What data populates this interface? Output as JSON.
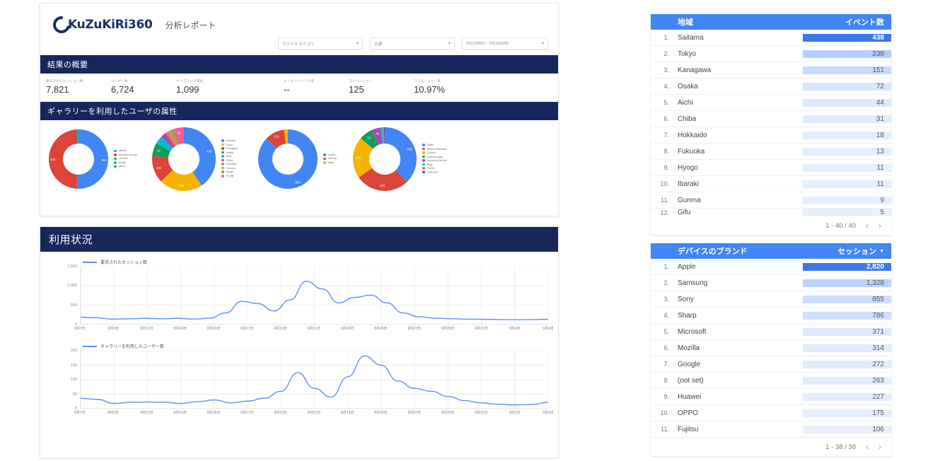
{
  "header": {
    "brand": "KuZuKiRi360",
    "report_title": "分析レポート",
    "filters": [
      {
        "name": "device-category",
        "value": "デバイス カテゴリ"
      },
      {
        "name": "region",
        "value": "共通"
      },
      {
        "name": "date-range",
        "value": "2021/08/07 - 2021/09/05"
      }
    ]
  },
  "summary": {
    "section_title": "結果の概要",
    "metrics": [
      {
        "label": "要求されたセッション数",
        "value": "7,821"
      },
      {
        "label": "ユーザー数",
        "value": "6,724"
      },
      {
        "label": "ギャラリーの開始",
        "value": "1,099"
      },
      {
        "label": "エンゲージメント率",
        "value": "--"
      },
      {
        "label": "コンバージョン",
        "value": "125"
      },
      {
        "label": "コンバージョン率",
        "value": "10.97%"
      }
    ]
  },
  "attributes": {
    "section_title": "ギャラリーを利用したユーザの属性",
    "donuts": [
      {
        "name": "traffic-source",
        "slices": [
          {
            "label": "(direct)",
            "value": 563,
            "color": "#4285f4",
            "show_label": true
          },
          {
            "label": "shinkoku-mou.jp",
            "value": 526,
            "color": "#db4437",
            "show_label": true
          },
          {
            "label": "(not set)",
            "value": 8,
            "color": "#0f9d58",
            "show_label": false
          },
          {
            "label": "google",
            "value": 4,
            "color": "#00bcd4",
            "show_label": false
          },
          {
            "label": "yahoo",
            "value": 2,
            "color": "#0f9d58",
            "show_label": false
          }
        ]
      },
      {
        "name": "region",
        "slices": [
          {
            "label": "Saitama",
            "value": 438,
            "color": "#4285f4",
            "show_label": true
          },
          {
            "label": "Tokyo",
            "value": 238,
            "color": "#f4b400",
            "show_label": true
          },
          {
            "label": "Kanagawa",
            "value": 151,
            "color": "#db4437",
            "show_label": true
          },
          {
            "label": "Osaka",
            "value": 72,
            "color": "#0f9d58",
            "show_label": true
          },
          {
            "label": "Aichi",
            "value": 44,
            "color": "#00bcd4",
            "show_label": false
          },
          {
            "label": "Chiba",
            "value": 31,
            "color": "#ab47bc",
            "show_label": false
          },
          {
            "label": "Hokkaido",
            "value": 18,
            "color": "#ff7043",
            "show_label": false
          },
          {
            "label": "Fukuoka",
            "value": 13,
            "color": "#9e9e9e",
            "show_label": false
          },
          {
            "label": "Hyogo",
            "value": 11,
            "color": "#9e9d24",
            "show_label": false
          },
          {
            "label": "その他",
            "value": 63,
            "color": "#f06292",
            "show_label": true
          }
        ]
      },
      {
        "name": "device-category",
        "slices": [
          {
            "label": "mobile",
            "value": 958,
            "color": "#4285f4",
            "show_label": true
          },
          {
            "label": "desktop",
            "value": 118,
            "color": "#db4437",
            "show_label": true
          },
          {
            "label": "tablet",
            "value": 23,
            "color": "#f4b400",
            "show_label": false
          }
        ]
      },
      {
        "name": "browser",
        "slices": [
          {
            "label": "Safari",
            "value": 399,
            "color": "#4285f4",
            "show_label": true
          },
          {
            "label": "Android Webview",
            "value": 290,
            "color": "#db4437",
            "show_label": true
          },
          {
            "label": "Chrome",
            "value": 223,
            "color": "#f4b400",
            "show_label": true
          },
          {
            "label": "Safari (in-app)",
            "value": 74,
            "color": "#0f9d58",
            "show_label": true
          },
          {
            "label": "Samsung Internet",
            "value": 46,
            "color": "#ab47bc",
            "show_label": true
          },
          {
            "label": "Edge",
            "value": 12,
            "color": "#00bcd4",
            "show_label": false
          },
          {
            "label": "Firefox",
            "value": 8,
            "color": "#ff7043",
            "show_label": false
          },
          {
            "label": "LINE/APP",
            "value": 4,
            "color": "#3f51b5",
            "show_label": false
          }
        ]
      }
    ]
  },
  "usage": {
    "section_title": "利用状況",
    "charts": [
      {
        "name": "sessions-over-time",
        "legend": "要求されたセッション数",
        "color": "#5b8ff9",
        "yticks": [
          "1,500",
          "1,000",
          "500",
          "0"
        ],
        "ymax": 1500,
        "xticks": [
          "8月7日",
          "8月9日",
          "8月11日",
          "8月13日",
          "8月15日",
          "8月17日",
          "8月19日",
          "8月21日",
          "8月23日",
          "8月25日",
          "8月27日",
          "8月29日",
          "8月31日",
          "9月2日",
          "9月4日"
        ]
      },
      {
        "name": "gallery-users-over-time",
        "legend": "ギャラリーを利用したユーザー数",
        "color": "#5b8ff9",
        "yticks": [
          "200",
          "150",
          "100",
          "50",
          "0"
        ],
        "ymax": 200,
        "xticks": [
          "8月7日",
          "8月9日",
          "8月11日",
          "8月13日",
          "8月15日",
          "8月17日",
          "8月19日",
          "8月21日",
          "8月23日",
          "8月25日",
          "8月27日",
          "8月29日",
          "8月31日",
          "9月2日",
          "9月4日"
        ]
      }
    ]
  },
  "chart_data": [
    {
      "type": "line",
      "name": "sessions-over-time",
      "title": "要求されたセッション数",
      "xlabel": "",
      "ylabel": "",
      "ylim": [
        0,
        1500
      ],
      "grid": true,
      "legend_position": "top-left",
      "x": [
        "8月7日",
        "8月8日",
        "8月9日",
        "8月10日",
        "8月11日",
        "8月12日",
        "8月13日",
        "8月14日",
        "8月15日",
        "8月16日",
        "8月17日",
        "8月18日",
        "8月19日",
        "8月20日",
        "8月21日",
        "8月22日",
        "8月23日",
        "8月24日",
        "8月25日",
        "8月26日",
        "8月27日",
        "8月28日",
        "8月29日",
        "8月30日",
        "8月31日",
        "9月1日",
        "9月2日",
        "9月3日",
        "9月4日",
        "9月5日"
      ],
      "series": [
        {
          "name": "要求されたセッション数",
          "values": [
            190,
            175,
            140,
            150,
            160,
            150,
            160,
            140,
            165,
            300,
            600,
            540,
            350,
            640,
            1120,
            920,
            560,
            700,
            760,
            560,
            300,
            200,
            165,
            150,
            140,
            135,
            130,
            125,
            130,
            135
          ]
        }
      ]
    },
    {
      "type": "line",
      "name": "gallery-users-over-time",
      "title": "ギャラリーを利用したユーザー数",
      "xlabel": "",
      "ylabel": "",
      "ylim": [
        0,
        200
      ],
      "grid": true,
      "legend_position": "top-left",
      "x": [
        "8月7日",
        "8月8日",
        "8月9日",
        "8月10日",
        "8月11日",
        "8月12日",
        "8月13日",
        "8月14日",
        "8月15日",
        "8月16日",
        "8月17日",
        "8月18日",
        "8月19日",
        "8月20日",
        "8月21日",
        "8月22日",
        "8月23日",
        "8月25日",
        "8月26日",
        "8月27日",
        "8月28日",
        "8月29日",
        "8月30日",
        "8月31日",
        "9月1日",
        "9月2日",
        "9月3日",
        "9月4日",
        "9月5日"
      ],
      "series": [
        {
          "name": "ギャラリーを利用したユーザー数",
          "values": [
            36,
            32,
            18,
            22,
            23,
            22,
            18,
            24,
            30,
            20,
            26,
            36,
            60,
            124,
            70,
            40,
            110,
            182,
            150,
            95,
            70,
            60,
            42,
            28,
            20,
            15,
            13,
            14,
            22
          ]
        }
      ]
    }
  ],
  "tables": [
    {
      "name": "region-table",
      "col_rank": "",
      "col_dim": "地域",
      "col_metric": "イベント数",
      "sortable": false,
      "rows": [
        {
          "rank": "1.",
          "dim": "Saitama",
          "metric": "438"
        },
        {
          "rank": "2.",
          "dim": "Tokyo",
          "metric": "238"
        },
        {
          "rank": "3.",
          "dim": "Kanagawa",
          "metric": "151"
        },
        {
          "rank": "4.",
          "dim": "Osaka",
          "metric": "72"
        },
        {
          "rank": "5.",
          "dim": "Aichi",
          "metric": "44"
        },
        {
          "rank": "6.",
          "dim": "Chiba",
          "metric": "31"
        },
        {
          "rank": "7.",
          "dim": "Hokkaido",
          "metric": "18"
        },
        {
          "rank": "8.",
          "dim": "Fukuoka",
          "metric": "13"
        },
        {
          "rank": "9.",
          "dim": "Hyogo",
          "metric": "11"
        },
        {
          "rank": "10.",
          "dim": "Ibaraki",
          "metric": "11"
        },
        {
          "rank": "11.",
          "dim": "Gunma",
          "metric": "9"
        },
        {
          "rank": "12.",
          "dim": "Gifu",
          "metric": "5"
        }
      ],
      "bar_fractions": [
        1.0,
        0.55,
        0.36,
        0.2,
        0.14,
        0.11,
        0.08,
        0.07,
        0.06,
        0.06,
        0.05,
        0.04
      ],
      "pagination": "1 - 40 / 40"
    },
    {
      "name": "device-brand-table",
      "col_rank": "",
      "col_dim": "デバイスのブランド",
      "col_metric": "セッション",
      "sortable": true,
      "rows": [
        {
          "rank": "1.",
          "dim": "Apple",
          "metric": "2,820"
        },
        {
          "rank": "2.",
          "dim": "Samsung",
          "metric": "1,328"
        },
        {
          "rank": "3.",
          "dim": "Sony",
          "metric": "855"
        },
        {
          "rank": "4.",
          "dim": "Sharp",
          "metric": "786"
        },
        {
          "rank": "5.",
          "dim": "Microsoft",
          "metric": "371"
        },
        {
          "rank": "6.",
          "dim": "Mozilla",
          "metric": "314"
        },
        {
          "rank": "7.",
          "dim": "Google",
          "metric": "272"
        },
        {
          "rank": "8.",
          "dim": "(not set)",
          "metric": "263"
        },
        {
          "rank": "9.",
          "dim": "Huawei",
          "metric": "227"
        },
        {
          "rank": "10.",
          "dim": "OPPO",
          "metric": "175"
        },
        {
          "rank": "11.",
          "dim": "Fujitsu",
          "metric": "106"
        }
      ],
      "bar_fractions": [
        1.0,
        0.47,
        0.3,
        0.28,
        0.13,
        0.11,
        0.1,
        0.09,
        0.08,
        0.06,
        0.04
      ],
      "pagination": "1 - 38 / 38"
    }
  ],
  "pager_icons": {
    "prev": "‹",
    "next": "›"
  },
  "colors": {
    "header_navy": "#16275c",
    "table_blue": "#4285f4",
    "line_blue": "#5b8ff9"
  }
}
